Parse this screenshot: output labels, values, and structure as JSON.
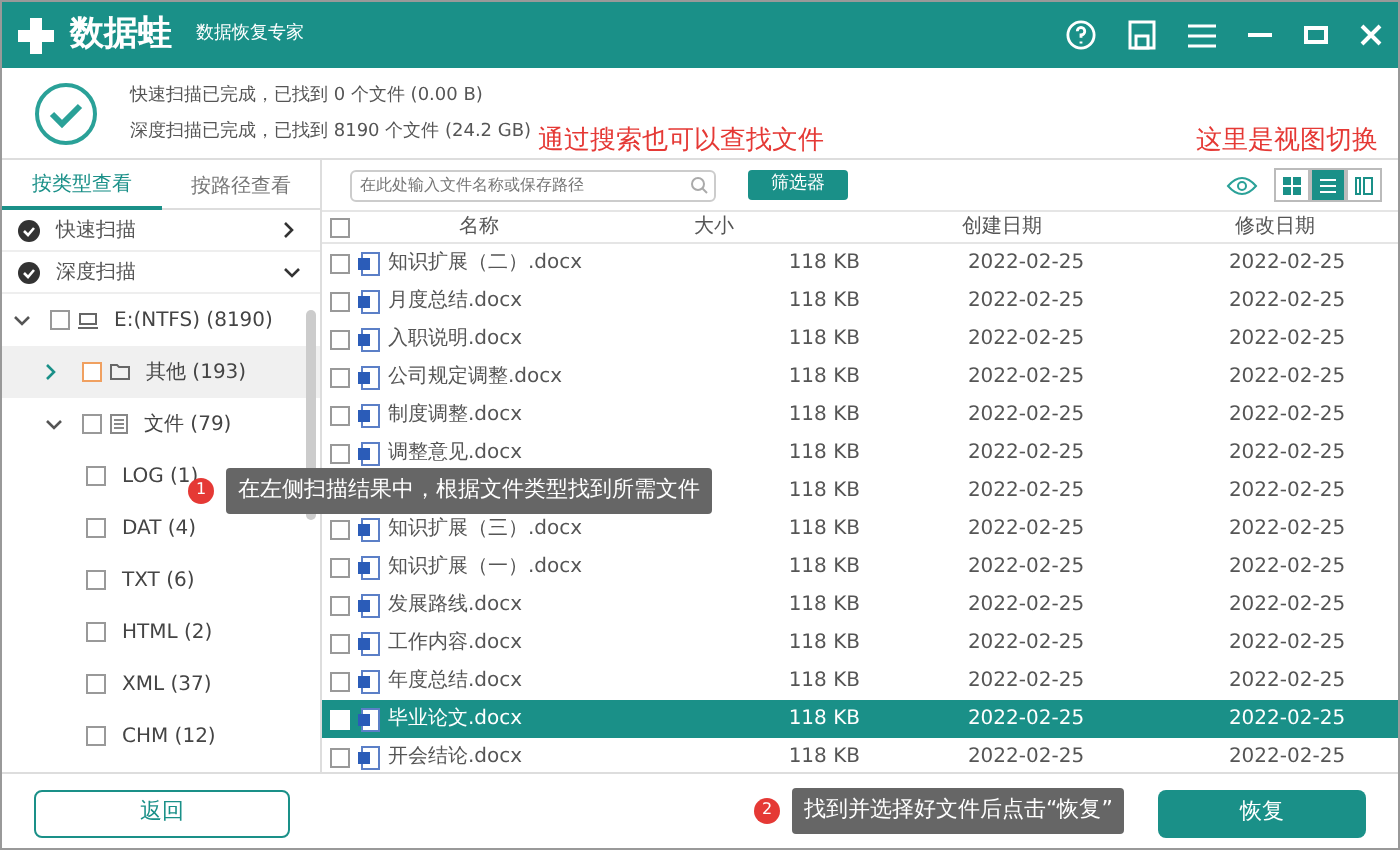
{
  "window": {
    "title": "数据蛙",
    "subtitle": "数据恢复专家"
  },
  "scan_status": [
    "快速扫描已完成，已找到 0 个文件 (0.00  B)",
    "深度扫描已完成，已找到 8190 个文件 (24.2 GB)"
  ],
  "annotations": [
    "通过搜索也可以查找文件",
    "这里是视图切换"
  ],
  "left_tabs": [
    {
      "label": "按类型查看",
      "selected": true
    },
    {
      "label": "按路径查看",
      "selected": false
    }
  ],
  "scans": [
    {
      "label": "快速扫描",
      "expanded": false
    },
    {
      "label": "深度扫描",
      "expanded": true
    }
  ],
  "tree": [
    {
      "label": "E:(NTFS) (8190)",
      "kind": "drive",
      "expanded": true,
      "selected": false,
      "checked": false,
      "children": [
        {
          "label": "其他 (193)",
          "kind": "folder",
          "expanded": false,
          "selected": true,
          "checked": false
        },
        {
          "label": "文件 (79)",
          "kind": "doc",
          "expanded": true,
          "selected": false,
          "checked": false,
          "children": [
            {
              "label": "LOG (1)",
              "kind": "type",
              "selected": false,
              "checked": false
            },
            {
              "label": "DAT (4)",
              "kind": "type",
              "selected": false,
              "checked": false
            },
            {
              "label": "TXT (6)",
              "kind": "type",
              "selected": false,
              "checked": false
            },
            {
              "label": "HTML (2)",
              "kind": "type",
              "selected": false,
              "checked": false
            },
            {
              "label": "XML (37)",
              "kind": "type",
              "selected": false,
              "checked": false
            },
            {
              "label": "CHM (12)",
              "kind": "type",
              "selected": false,
              "checked": false
            }
          ]
        }
      ]
    }
  ],
  "search": {
    "placeholder": "在此处输入文件名称或保存路径"
  },
  "filter_button": "筛选器",
  "view_buttons": [
    {
      "kind": "grid",
      "selected": false
    },
    {
      "kind": "list",
      "selected": true
    },
    {
      "kind": "detail",
      "selected": false
    }
  ],
  "table": {
    "select_all_checked": false,
    "columns": [
      "名称",
      "大小",
      "创建日期",
      "修改日期"
    ],
    "rows": [
      {
        "name": "知识扩展（二）.docx",
        "size": "118 KB",
        "created": "2022-02-25",
        "modified": "2022-02-25",
        "selected": false
      },
      {
        "name": "月度总结.docx",
        "size": "118 KB",
        "created": "2022-02-25",
        "modified": "2022-02-25",
        "selected": false
      },
      {
        "name": "入职说明.docx",
        "size": "118 KB",
        "created": "2022-02-25",
        "modified": "2022-02-25",
        "selected": false
      },
      {
        "name": "公司规定调整.docx",
        "size": "118 KB",
        "created": "2022-02-25",
        "modified": "2022-02-25",
        "selected": false
      },
      {
        "name": "制度调整.docx",
        "size": "118 KB",
        "created": "2022-02-25",
        "modified": "2022-02-25",
        "selected": false
      },
      {
        "name": "调整意见.docx",
        "size": "118 KB",
        "created": "2022-02-25",
        "modified": "2022-02-25",
        "selected": false
      },
      {
        "size": "118 KB",
        "created": "2022-02-25",
        "modified": "2022-02-25",
        "selected": false
      },
      {
        "name": "知识扩展（三）.docx",
        "size": "118 KB",
        "created": "2022-02-25",
        "modified": "2022-02-25",
        "selected": false
      },
      {
        "name": "知识扩展（一）.docx",
        "size": "118 KB",
        "created": "2022-02-25",
        "modified": "2022-02-25",
        "selected": false
      },
      {
        "name": "发展路线.docx",
        "size": "118 KB",
        "created": "2022-02-25",
        "modified": "2022-02-25",
        "selected": false
      },
      {
        "name": "工作内容.docx",
        "size": "118 KB",
        "created": "2022-02-25",
        "modified": "2022-02-25",
        "selected": false
      },
      {
        "name": "年度总结.docx",
        "size": "118 KB",
        "created": "2022-02-25",
        "modified": "2022-02-25",
        "selected": false
      },
      {
        "name": "毕业论文.docx",
        "size": "118 KB",
        "created": "2022-02-25",
        "modified": "2022-02-25",
        "selected": true
      },
      {
        "name": "开会结论.docx",
        "size": "118 KB",
        "created": "2022-02-25",
        "modified": "2022-02-25",
        "selected": false
      }
    ]
  },
  "tips": [
    {
      "number": "1",
      "text": "在左侧扫描结果中，根据文件类型找到所需文件"
    },
    {
      "number": "2",
      "text": "找到并选择好文件后点击“恢复”"
    }
  ],
  "back_button": "返回",
  "recover_button": "恢复"
}
